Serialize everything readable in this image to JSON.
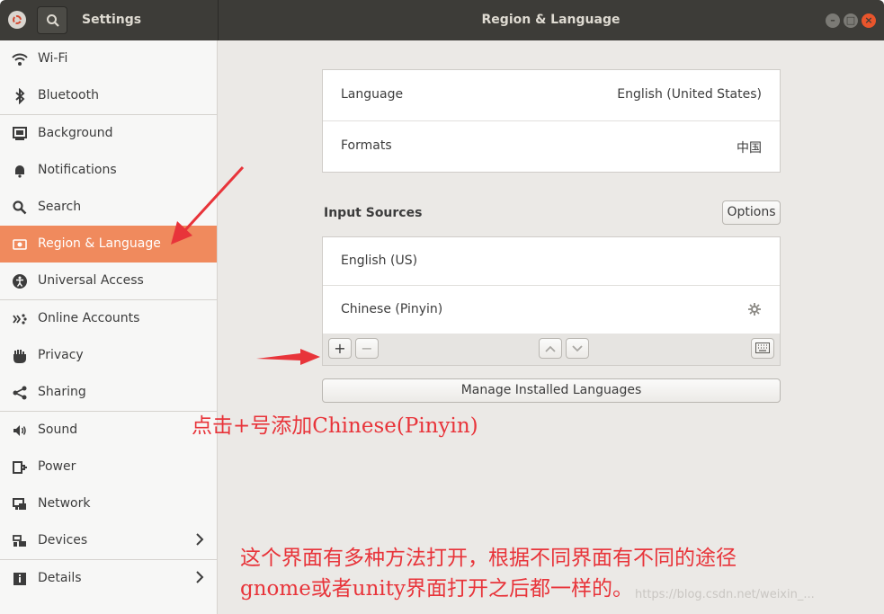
{
  "titlebar": {
    "app_title": "Settings",
    "panel_title": "Region & Language",
    "controls": [
      "minimize-icon",
      "maximize-icon",
      "close-icon"
    ]
  },
  "sidebar": {
    "items": [
      {
        "label": "Wi-Fi",
        "icon": "wifi-icon"
      },
      {
        "label": "Bluetooth",
        "icon": "bluetooth-icon"
      },
      {
        "label": "Background",
        "icon": "background-icon"
      },
      {
        "label": "Notifications",
        "icon": "bell-icon"
      },
      {
        "label": "Search",
        "icon": "search-icon"
      },
      {
        "label": "Region & Language",
        "icon": "flag-icon",
        "active": true
      },
      {
        "label": "Universal Access",
        "icon": "accessibility-icon"
      },
      {
        "label": "Online Accounts",
        "icon": "accounts-icon"
      },
      {
        "label": "Privacy",
        "icon": "hand-icon"
      },
      {
        "label": "Sharing",
        "icon": "share-icon"
      },
      {
        "label": "Sound",
        "icon": "speaker-icon"
      },
      {
        "label": "Power",
        "icon": "power-icon"
      },
      {
        "label": "Network",
        "icon": "network-icon"
      },
      {
        "label": "Devices",
        "icon": "devices-icon",
        "chevron": true
      },
      {
        "label": "Details",
        "icon": "info-icon",
        "chevron": true
      }
    ]
  },
  "main": {
    "language_label": "Language",
    "language_value": "English (United States)",
    "formats_label": "Formats",
    "formats_value": "中国",
    "input_sources_title": "Input Sources",
    "options_label": "Options",
    "sources": [
      "English (US)",
      "Chinese (Pinyin)"
    ],
    "add_label": "+",
    "remove_label": "−",
    "manage_label": "Manage Installed Languages"
  },
  "annotations": {
    "note1": "点击+号添加Chinese(Pinyin)",
    "note2_line1": "这个界面有多种方法打开，根据不同界面有不同的途径",
    "note2_line2": "gnome或者unity界面打开之后都一样的。",
    "watermark": "https://blog.csdn.net/weixin_..."
  },
  "colors": {
    "accent": "#f08a5d",
    "titlebar": "#3d3c38",
    "annotation": "#e8343a"
  }
}
